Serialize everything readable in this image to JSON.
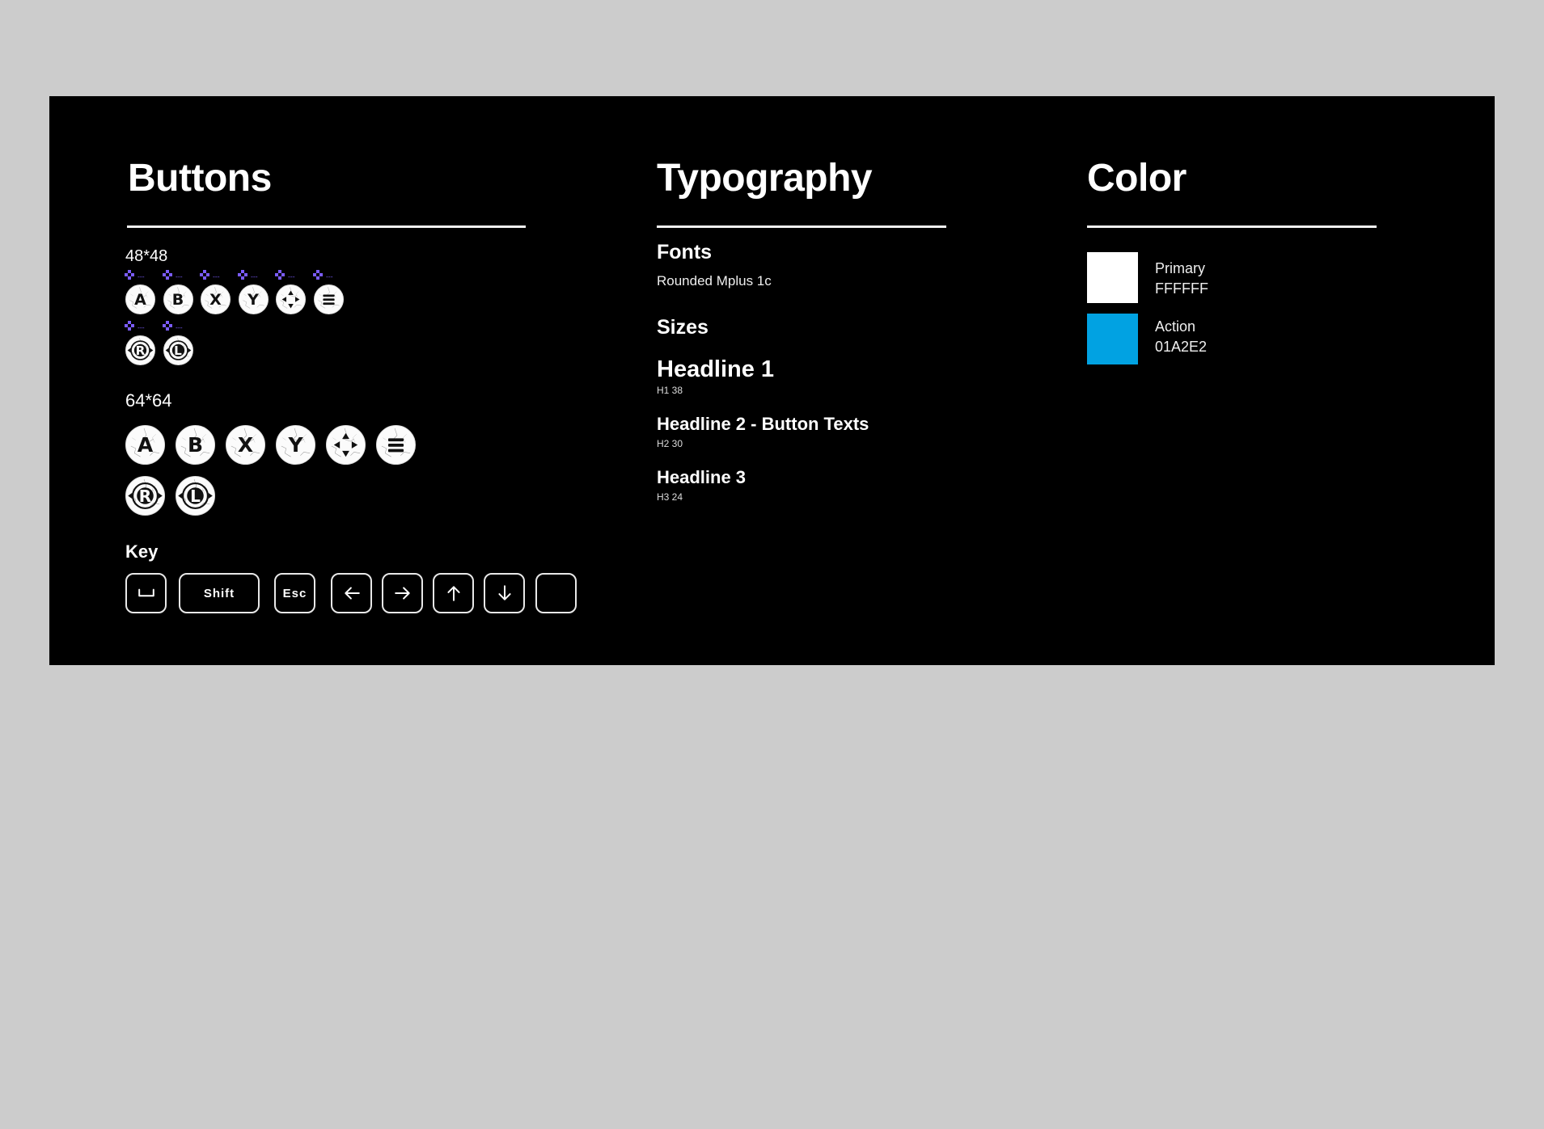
{
  "sections": {
    "buttons": {
      "title": "Buttons",
      "small": {
        "size_label": "48*48",
        "row1": [
          {
            "glyph": "A",
            "icon": "a-button-icon"
          },
          {
            "glyph": "B",
            "icon": "b-button-icon"
          },
          {
            "glyph": "X",
            "icon": "x-button-icon"
          },
          {
            "glyph": "Y",
            "icon": "y-button-icon"
          },
          {
            "glyph": "",
            "icon": "dpad-button-icon"
          },
          {
            "glyph": "",
            "icon": "menu-button-icon"
          }
        ],
        "row2": [
          {
            "glyph": "R",
            "icon": "r-stick-button-icon"
          },
          {
            "glyph": "L",
            "icon": "l-stick-button-icon"
          }
        ],
        "marker_text": "---"
      },
      "large": {
        "size_label": "64*64",
        "row1": [
          {
            "glyph": "A",
            "icon": "a-button-icon"
          },
          {
            "glyph": "B",
            "icon": "b-button-icon"
          },
          {
            "glyph": "X",
            "icon": "x-button-icon"
          },
          {
            "glyph": "Y",
            "icon": "y-button-icon"
          },
          {
            "glyph": "",
            "icon": "dpad-button-icon"
          },
          {
            "glyph": "",
            "icon": "menu-button-icon"
          }
        ],
        "row2": [
          {
            "glyph": "R",
            "icon": "r-stick-button-icon"
          },
          {
            "glyph": "L",
            "icon": "l-stick-button-icon"
          }
        ]
      },
      "keys": {
        "title": "Key",
        "items": [
          {
            "label": "",
            "icon": "space-key-icon"
          },
          {
            "label": "Shift",
            "icon": ""
          },
          {
            "label": "Esc",
            "icon": ""
          },
          {
            "label": "",
            "icon": "arrow-left-icon"
          },
          {
            "label": "",
            "icon": "arrow-right-icon"
          },
          {
            "label": "",
            "icon": "arrow-up-icon"
          },
          {
            "label": "",
            "icon": "arrow-down-icon"
          },
          {
            "label": "",
            "icon": ""
          }
        ]
      }
    },
    "typography": {
      "title": "Typography",
      "fonts_heading": "Fonts",
      "font_name": "Rounded Mplus 1c",
      "sizes_heading": "Sizes",
      "sizes": [
        {
          "name": "Headline 1",
          "spec": "H1 38"
        },
        {
          "name": "Headline 2 - Button Texts",
          "spec": "H2 30"
        },
        {
          "name": "Headline 3",
          "spec": "H3 24"
        }
      ]
    },
    "color": {
      "title": "Color",
      "swatches": [
        {
          "name": "Primary",
          "hex": "FFFFFF",
          "color": "#FFFFFF"
        },
        {
          "name": "Action",
          "hex": "01A2E2",
          "color": "#01A2E2"
        }
      ]
    }
  },
  "colors": {
    "panel_bg": "#000000",
    "page_bg": "#CCCCCC",
    "marker": "#7B5CFF"
  }
}
